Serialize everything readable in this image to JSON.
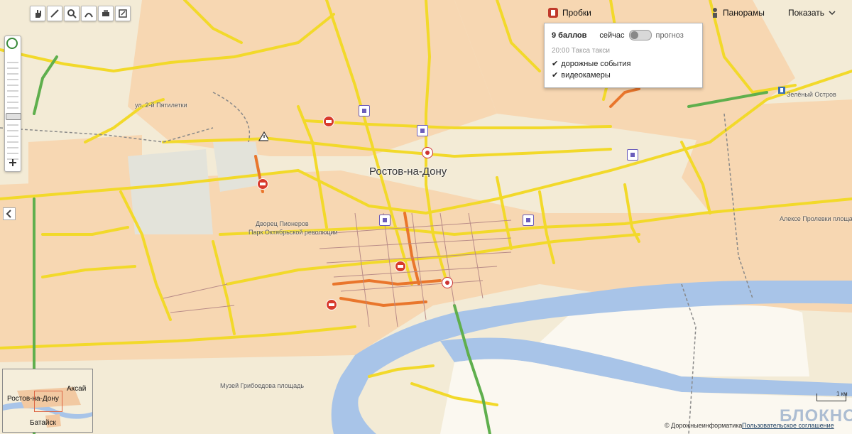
{
  "toolbar": {
    "tools": [
      {
        "icon": "hand-icon"
      },
      {
        "icon": "ruler-icon"
      },
      {
        "icon": "magnifier-icon"
      },
      {
        "icon": "route-icon"
      },
      {
        "icon": "print-icon"
      },
      {
        "icon": "link-icon"
      }
    ]
  },
  "traffic": {
    "button_label": "Пробки",
    "score": "9 баллов",
    "now_label": "сейчас",
    "forecast_label": "прогноз",
    "time_text": "20:00 Такса такси",
    "items": [
      {
        "label": "дорожные события",
        "checked": true
      },
      {
        "label": "видеокамеры",
        "checked": true
      }
    ],
    "accent_color": "#c0392b"
  },
  "panoramas": {
    "label": "Панорамы"
  },
  "show_menu": {
    "label": "Показать"
  },
  "map": {
    "city_label": "Ростов-на-Дону",
    "labels": [
      {
        "text": "ул. 2-й Пятилетки"
      },
      {
        "text": "Дворец Пионеров"
      },
      {
        "text": "Парк Октябрьской революции"
      },
      {
        "text": "Алексе Пролевки площадь"
      },
      {
        "text": "Зелёный Остров"
      },
      {
        "text": "Музей Грибоедова площадь"
      }
    ],
    "colors": {
      "land": "#f3ebd6",
      "district": "#f7d7b2",
      "water": "#a8c4e8",
      "road_major": "#f7e33a",
      "road_jam": "#e97a2c",
      "road_free": "#5faf4d"
    }
  },
  "minimap": {
    "labels": [
      {
        "text": "Аксай"
      },
      {
        "text": "Ростов-на-Дону"
      },
      {
        "text": "Батайск"
      }
    ]
  },
  "footer": {
    "copyright": "© Дорожныеинформатика",
    "terms": "Пользовательское соглашение",
    "watermark": "БЛОКНОТ",
    "scale_label": "1 км"
  }
}
